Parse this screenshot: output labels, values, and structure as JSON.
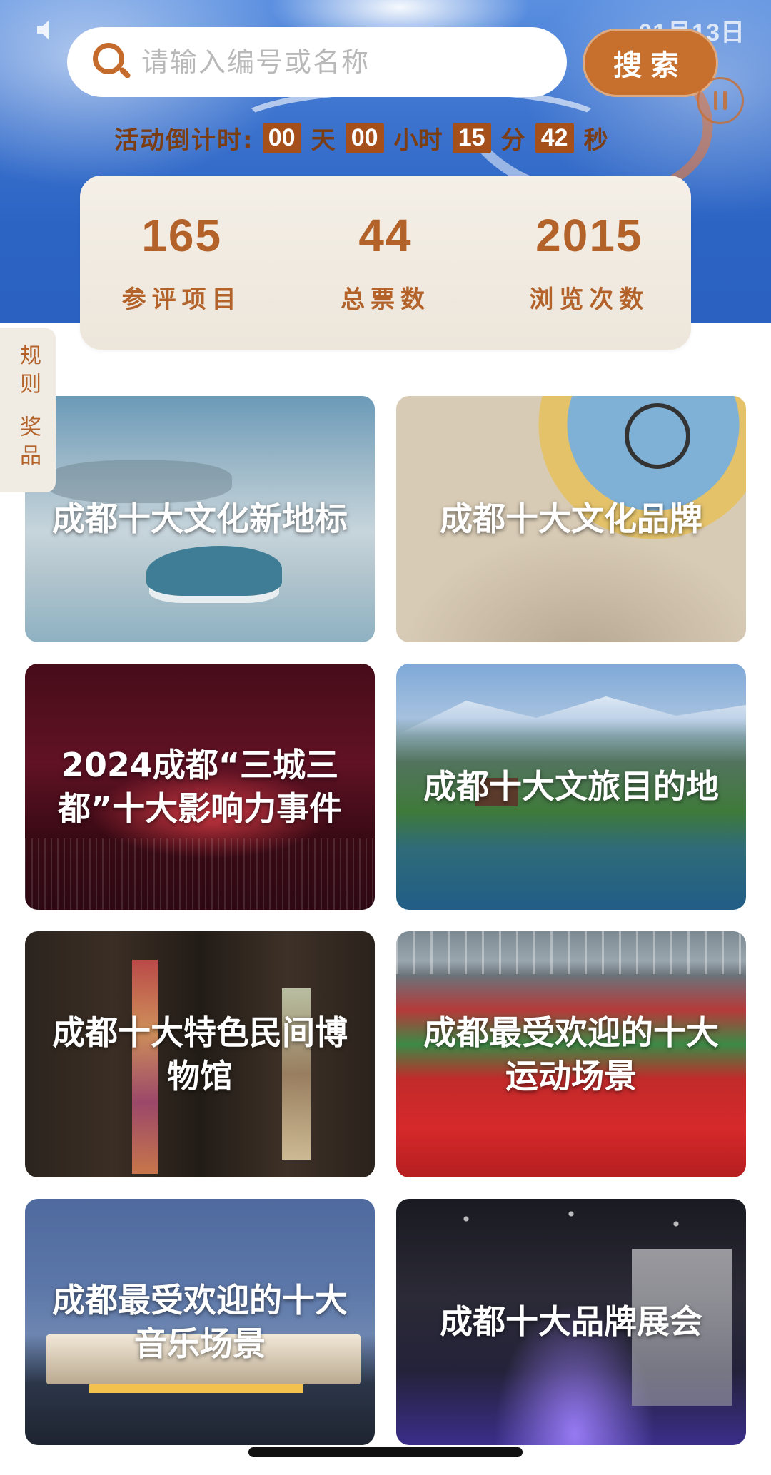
{
  "status": {
    "date": "01月13日"
  },
  "search": {
    "placeholder": "请输入编号或名称",
    "button_label": "搜索"
  },
  "countdown": {
    "label": "活动倒计时:",
    "days": "00",
    "days_unit": "天",
    "hours": "00",
    "hours_unit": "小时",
    "minutes": "15",
    "minutes_unit": "分",
    "seconds": "42",
    "seconds_unit": "秒"
  },
  "stats": [
    {
      "value": "165",
      "label": "参评项目"
    },
    {
      "value": "44",
      "label": "总票数"
    },
    {
      "value": "2015",
      "label": "浏览次数"
    }
  ],
  "side_tab": {
    "rules": "规则",
    "prizes": "奖品"
  },
  "categories": [
    {
      "title": "成都十大文化新地标"
    },
    {
      "title": "成都十大文化品牌"
    },
    {
      "title": "2024成都“三城三都”十大影响力事件"
    },
    {
      "title": "成都十大文旅目的地"
    },
    {
      "title": "成都十大特色民间博物馆"
    },
    {
      "title": "成都最受欢迎的十大运动场景"
    },
    {
      "title": "成都最受欢迎的十大音乐场景"
    },
    {
      "title": "成都十大品牌展会"
    }
  ],
  "colors": {
    "accent": "#c7702e",
    "stat_text": "#b3622a",
    "countdown_box": "#a5501b",
    "hero_blue": "#2c64c4"
  }
}
